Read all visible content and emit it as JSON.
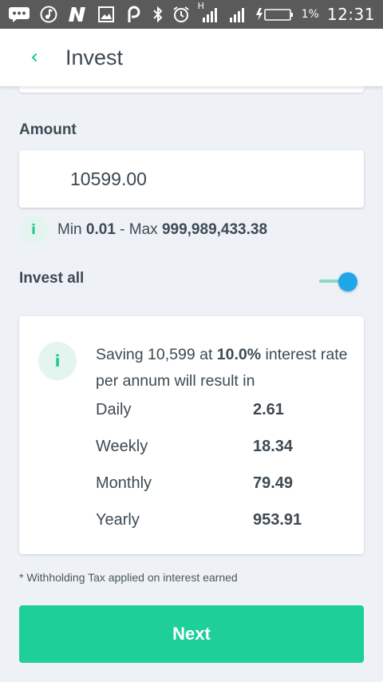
{
  "status_bar": {
    "time": "12:31",
    "battery_percent": "1%",
    "network_label": "H",
    "icons": [
      "messaging-icon",
      "music-icon",
      "n-app-icon",
      "image-icon",
      "p-app-icon",
      "bluetooth-icon",
      "alarm-icon",
      "signal-icon",
      "signal-icon",
      "battery-charging-icon"
    ]
  },
  "header": {
    "back_icon": "chevron-left-icon",
    "title": "Invest"
  },
  "amount": {
    "label": "Amount",
    "value": "10599.00"
  },
  "limits": {
    "min_label": "Min",
    "min_value": "0.01",
    "separator": "- Max",
    "max_value": "999,989,433.38"
  },
  "invest_all": {
    "label": "Invest all",
    "enabled": true
  },
  "calculation": {
    "text_prefix": "Saving 10,599 at",
    "rate": "10.0%",
    "text_suffix": "interest rate per annum will result in",
    "rows": [
      {
        "label": "Daily",
        "value": "2.61"
      },
      {
        "label": "Weekly",
        "value": "18.34"
      },
      {
        "label": "Monthly",
        "value": "79.49"
      },
      {
        "label": "Yearly",
        "value": "953.91"
      }
    ]
  },
  "footnote": "* Withholding Tax applied on interest earned",
  "next_button": "Next",
  "colors": {
    "accent": "#1ecf9a",
    "toggle_thumb": "#1ea7e8",
    "status_bar": "#5a5a5a"
  }
}
